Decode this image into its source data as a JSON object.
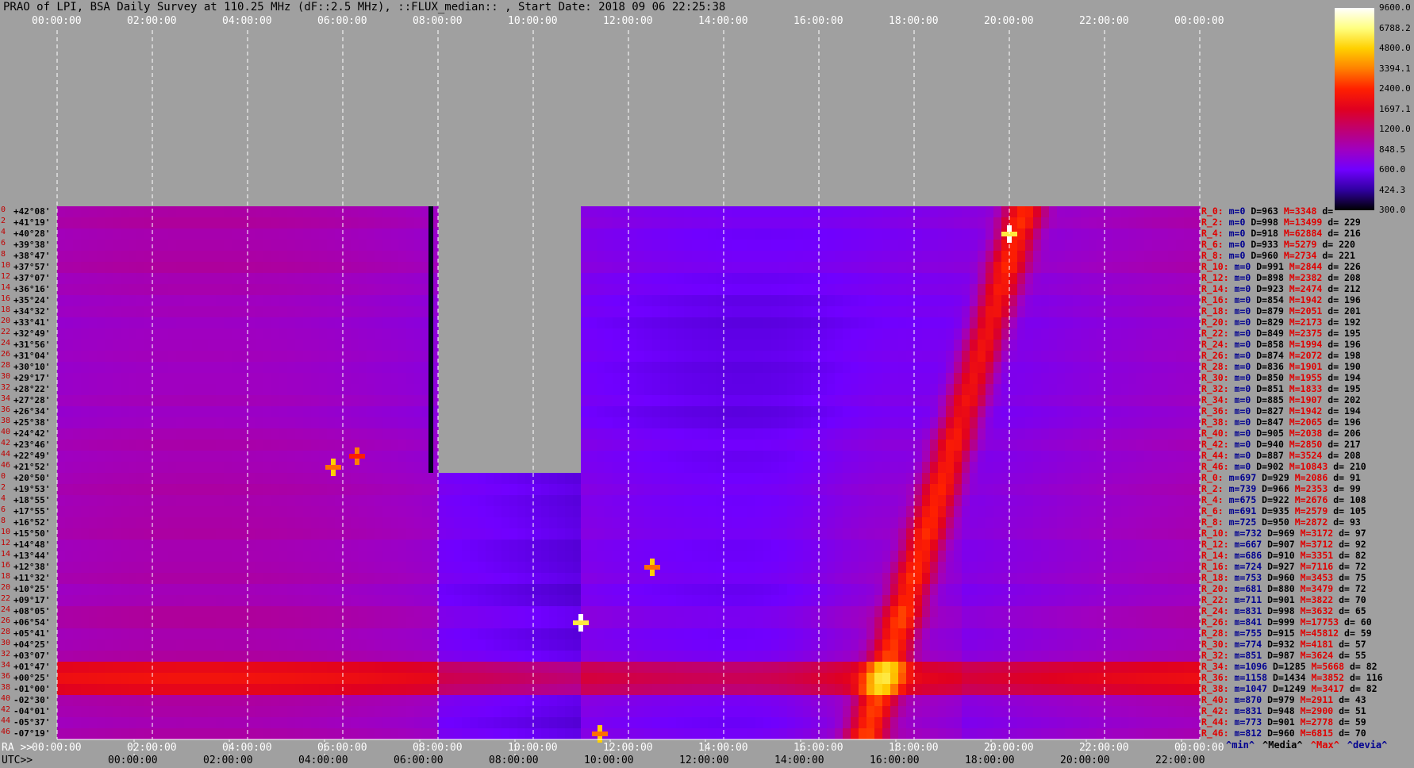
{
  "title": "PRAO of LPI, BSA Daily Survey at 110.25 MHz (dF::2.5 MHz), ::FLUX_median:: , Start Date: 2018 09 06 22:25:38",
  "colors": {
    "background": "#a0a0a0",
    "grid": "#ffffff",
    "stat_red": "#e00000",
    "stat_blue": "#000090"
  },
  "chart_data": {
    "type": "heatmap",
    "x_top_ticks": [
      "00:00:00",
      "02:00:00",
      "04:00:00",
      "06:00:00",
      "08:00:00",
      "10:00:00",
      "12:00:00",
      "14:00:00",
      "16:00:00",
      "18:00:00",
      "20:00:00",
      "22:00:00",
      "00:00:00"
    ],
    "ra_label": "RA >>",
    "ra_ticks": [
      "00:00:00",
      "02:00:00",
      "04:00:00",
      "06:00:00",
      "08:00:00",
      "10:00:00",
      "12:00:00",
      "14:00:00",
      "16:00:00",
      "18:00:00",
      "20:00:00",
      "22:00:00",
      "00:00:00"
    ],
    "utc_label": "UTC>>",
    "utc_ticks": [
      "00:00:00",
      "02:00:00",
      "04:00:00",
      "06:00:00",
      "08:00:00",
      "10:00:00",
      "12:00:00",
      "14:00:00",
      "16:00:00",
      "18:00:00",
      "20:00:00",
      "22:00:00"
    ],
    "declinations": [
      "+42°08'",
      "+41°19'",
      "+40°28'",
      "+39°38'",
      "+38°47'",
      "+37°57'",
      "+37°07'",
      "+36°16'",
      "+35°24'",
      "+34°32'",
      "+33°41'",
      "+32°49'",
      "+31°56'",
      "+31°04'",
      "+30°10'",
      "+29°17'",
      "+28°22'",
      "+27°28'",
      "+26°34'",
      "+25°38'",
      "+24°42'",
      "+23°46'",
      "+22°49'",
      "+21°52'",
      "+20°50'",
      "+19°53'",
      "+18°55'",
      "+17°55'",
      "+16°52'",
      "+15°50'",
      "+14°48'",
      "+13°44'",
      "+12°38'",
      "+11°32'",
      "+10°25'",
      "+09°17'",
      "+08°05'",
      "+06°54'",
      "+05°41'",
      "+04°25'",
      "+03°07'",
      "+01°47'",
      "+00°25'",
      "-01°00'",
      "-02°30'",
      "-04°01'",
      "-05°37'",
      "-07°19'"
    ],
    "row_indices": [
      "0",
      "2",
      "4",
      "6",
      "8",
      "10",
      "12",
      "14",
      "16",
      "18",
      "20",
      "22",
      "24",
      "26",
      "28",
      "30",
      "32",
      "34",
      "36",
      "38",
      "40",
      "42",
      "44",
      "46",
      "0",
      "2",
      "4",
      "6",
      "8",
      "10",
      "12",
      "14",
      "16",
      "18",
      "20",
      "22",
      "24",
      "26",
      "28",
      "30",
      "32",
      "34",
      "36",
      "38",
      "40",
      "42",
      "44",
      "46"
    ],
    "stats": [
      {
        "r": "R_0:",
        "m": "0",
        "D": "963",
        "M": "3348",
        "d": ""
      },
      {
        "r": "R_2:",
        "m": "0",
        "D": "998",
        "M": "13499",
        "d": "229"
      },
      {
        "r": "R_4:",
        "m": "0",
        "D": "918",
        "M": "62884",
        "d": "216"
      },
      {
        "r": "R_6:",
        "m": "0",
        "D": "933",
        "M": "5279",
        "d": "220"
      },
      {
        "r": "R_8:",
        "m": "0",
        "D": "960",
        "M": "2734",
        "d": "221"
      },
      {
        "r": "R_10:",
        "m": "0",
        "D": "991",
        "M": "2844",
        "d": "226"
      },
      {
        "r": "R_12:",
        "m": "0",
        "D": "898",
        "M": "2382",
        "d": "208"
      },
      {
        "r": "R_14:",
        "m": "0",
        "D": "923",
        "M": "2474",
        "d": "212"
      },
      {
        "r": "R_16:",
        "m": "0",
        "D": "854",
        "M": "1942",
        "d": "196"
      },
      {
        "r": "R_18:",
        "m": "0",
        "D": "879",
        "M": "2051",
        "d": "201"
      },
      {
        "r": "R_20:",
        "m": "0",
        "D": "829",
        "M": "2173",
        "d": "192"
      },
      {
        "r": "R_22:",
        "m": "0",
        "D": "849",
        "M": "2375",
        "d": "195"
      },
      {
        "r": "R_24:",
        "m": "0",
        "D": "858",
        "M": "1994",
        "d": "196"
      },
      {
        "r": "R_26:",
        "m": "0",
        "D": "874",
        "M": "2072",
        "d": "198"
      },
      {
        "r": "R_28:",
        "m": "0",
        "D": "836",
        "M": "1901",
        "d": "190"
      },
      {
        "r": "R_30:",
        "m": "0",
        "D": "850",
        "M": "1955",
        "d": "194"
      },
      {
        "r": "R_32:",
        "m": "0",
        "D": "851",
        "M": "1833",
        "d": "195"
      },
      {
        "r": "R_34:",
        "m": "0",
        "D": "885",
        "M": "1907",
        "d": "202"
      },
      {
        "r": "R_36:",
        "m": "0",
        "D": "827",
        "M": "1942",
        "d": "194"
      },
      {
        "r": "R_38:",
        "m": "0",
        "D": "847",
        "M": "2065",
        "d": "196"
      },
      {
        "r": "R_40:",
        "m": "0",
        "D": "905",
        "M": "2038",
        "d": "206"
      },
      {
        "r": "R_42:",
        "m": "0",
        "D": "940",
        "M": "2850",
        "d": "217"
      },
      {
        "r": "R_44:",
        "m": "0",
        "D": "887",
        "M": "3524",
        "d": "208"
      },
      {
        "r": "R_46:",
        "m": "0",
        "D": "902",
        "M": "10843",
        "d": "210"
      },
      {
        "r": "R_0:",
        "m": "697",
        "D": "929",
        "M": "2086",
        "d": "91"
      },
      {
        "r": "R_2:",
        "m": "739",
        "D": "966",
        "M": "2353",
        "d": "99"
      },
      {
        "r": "R_4:",
        "m": "675",
        "D": "922",
        "M": "2676",
        "d": "108"
      },
      {
        "r": "R_6:",
        "m": "691",
        "D": "935",
        "M": "2579",
        "d": "105"
      },
      {
        "r": "R_8:",
        "m": "725",
        "D": "950",
        "M": "2872",
        "d": "93"
      },
      {
        "r": "R_10:",
        "m": "732",
        "D": "969",
        "M": "3172",
        "d": "97"
      },
      {
        "r": "R_12:",
        "m": "667",
        "D": "907",
        "M": "3712",
        "d": "92"
      },
      {
        "r": "R_14:",
        "m": "686",
        "D": "910",
        "M": "3351",
        "d": "82"
      },
      {
        "r": "R_16:",
        "m": "724",
        "D": "927",
        "M": "7116",
        "d": "72"
      },
      {
        "r": "R_18:",
        "m": "753",
        "D": "960",
        "M": "3453",
        "d": "75"
      },
      {
        "r": "R_20:",
        "m": "681",
        "D": "880",
        "M": "3479",
        "d": "72"
      },
      {
        "r": "R_22:",
        "m": "711",
        "D": "901",
        "M": "3822",
        "d": "70"
      },
      {
        "r": "R_24:",
        "m": "831",
        "D": "998",
        "M": "3632",
        "d": "65"
      },
      {
        "r": "R_26:",
        "m": "841",
        "D": "999",
        "M": "17753",
        "d": "60"
      },
      {
        "r": "R_28:",
        "m": "755",
        "D": "915",
        "M": "45812",
        "d": "59"
      },
      {
        "r": "R_30:",
        "m": "774",
        "D": "932",
        "M": "4181",
        "d": "57"
      },
      {
        "r": "R_32:",
        "m": "851",
        "D": "987",
        "M": "3624",
        "d": "55"
      },
      {
        "r": "R_34:",
        "m": "1096",
        "D": "1285",
        "M": "5668",
        "d": "82"
      },
      {
        "r": "R_36:",
        "m": "1158",
        "D": "1434",
        "M": "3852",
        "d": "116"
      },
      {
        "r": "R_38:",
        "m": "1047",
        "D": "1249",
        "M": "3417",
        "d": "82"
      },
      {
        "r": "R_40:",
        "m": "870",
        "D": "979",
        "M": "2911",
        "d": "43"
      },
      {
        "r": "R_42:",
        "m": "831",
        "D": "948",
        "M": "2900",
        "d": "51"
      },
      {
        "r": "R_44:",
        "m": "773",
        "D": "901",
        "M": "2778",
        "d": "59"
      },
      {
        "r": "R_46:",
        "m": "812",
        "D": "960",
        "M": "6815",
        "d": "70"
      }
    ],
    "stat_prefixes": {
      "m": "m=",
      "D": "D=",
      "M": "M=",
      "d": "d= "
    },
    "legend": [
      {
        "label": "^min^",
        "color": "#000090"
      },
      {
        "label": "^Media^",
        "color": "#000000"
      },
      {
        "label": "^Max^",
        "color": "#e00000"
      },
      {
        "label": "^devia^",
        "color": "#000090"
      }
    ],
    "colorbar": {
      "labels": [
        "9600.0",
        "6788.2",
        "4800.0",
        "3394.1",
        "2400.0",
        "1697.1",
        "1200.0",
        "848.5",
        "600.0",
        "424.3",
        "300.0"
      ],
      "stops": [
        "#ffffff",
        "#ffff80",
        "#ffd000",
        "#ff8000",
        "#ff2000",
        "#e00020",
        "#c00070",
        "#a000c0",
        "#7000ff",
        "#3000a0",
        "#000000"
      ]
    },
    "features": {
      "gap_lower_half_hours": [
        8.0,
        11.0
      ],
      "gap_upper_half_hours": [
        8.0,
        11.0
      ],
      "dead_column_hour": 7.8,
      "galactic_plane_dec_rows": [
        41,
        43
      ],
      "drift_track": {
        "start_hour": 20.3,
        "end_hour": 17.0
      },
      "point_sources": [
        {
          "hour": 11.0,
          "row": 37,
          "value": 9600
        },
        {
          "hour": 20.0,
          "row": 2,
          "value": 9600
        },
        {
          "hour": 5.8,
          "row": 23,
          "value": 4800
        },
        {
          "hour": 6.3,
          "row": 22,
          "value": 3394
        },
        {
          "hour": 11.4,
          "row": 47,
          "value": 4800
        },
        {
          "hour": 12.5,
          "row": 32,
          "value": 4800
        }
      ]
    }
  }
}
